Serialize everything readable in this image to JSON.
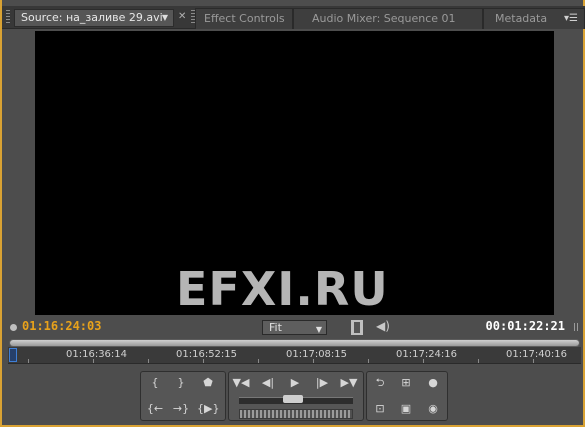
{
  "tabs": {
    "source": "Source: на_заливе 29.avi",
    "effect_controls": "Effect Controls",
    "audio_mixer": "Audio Mixer: Sequence 01",
    "metadata": "Metadata"
  },
  "timecode": {
    "current": "01:16:24:03",
    "duration": "00:01:22:21"
  },
  "zoom": {
    "selected": "Fit"
  },
  "ruler": {
    "labels": [
      "01:16:36:14",
      "01:16:52:15",
      "01:17:08:15",
      "01:17:24:16",
      "01:17:40:16"
    ]
  },
  "watermark": "EFXI.RU",
  "colors": {
    "accent_timecode": "#e8a21b",
    "panel_border": "#d9a233",
    "playhead": "#3f7fd6"
  }
}
